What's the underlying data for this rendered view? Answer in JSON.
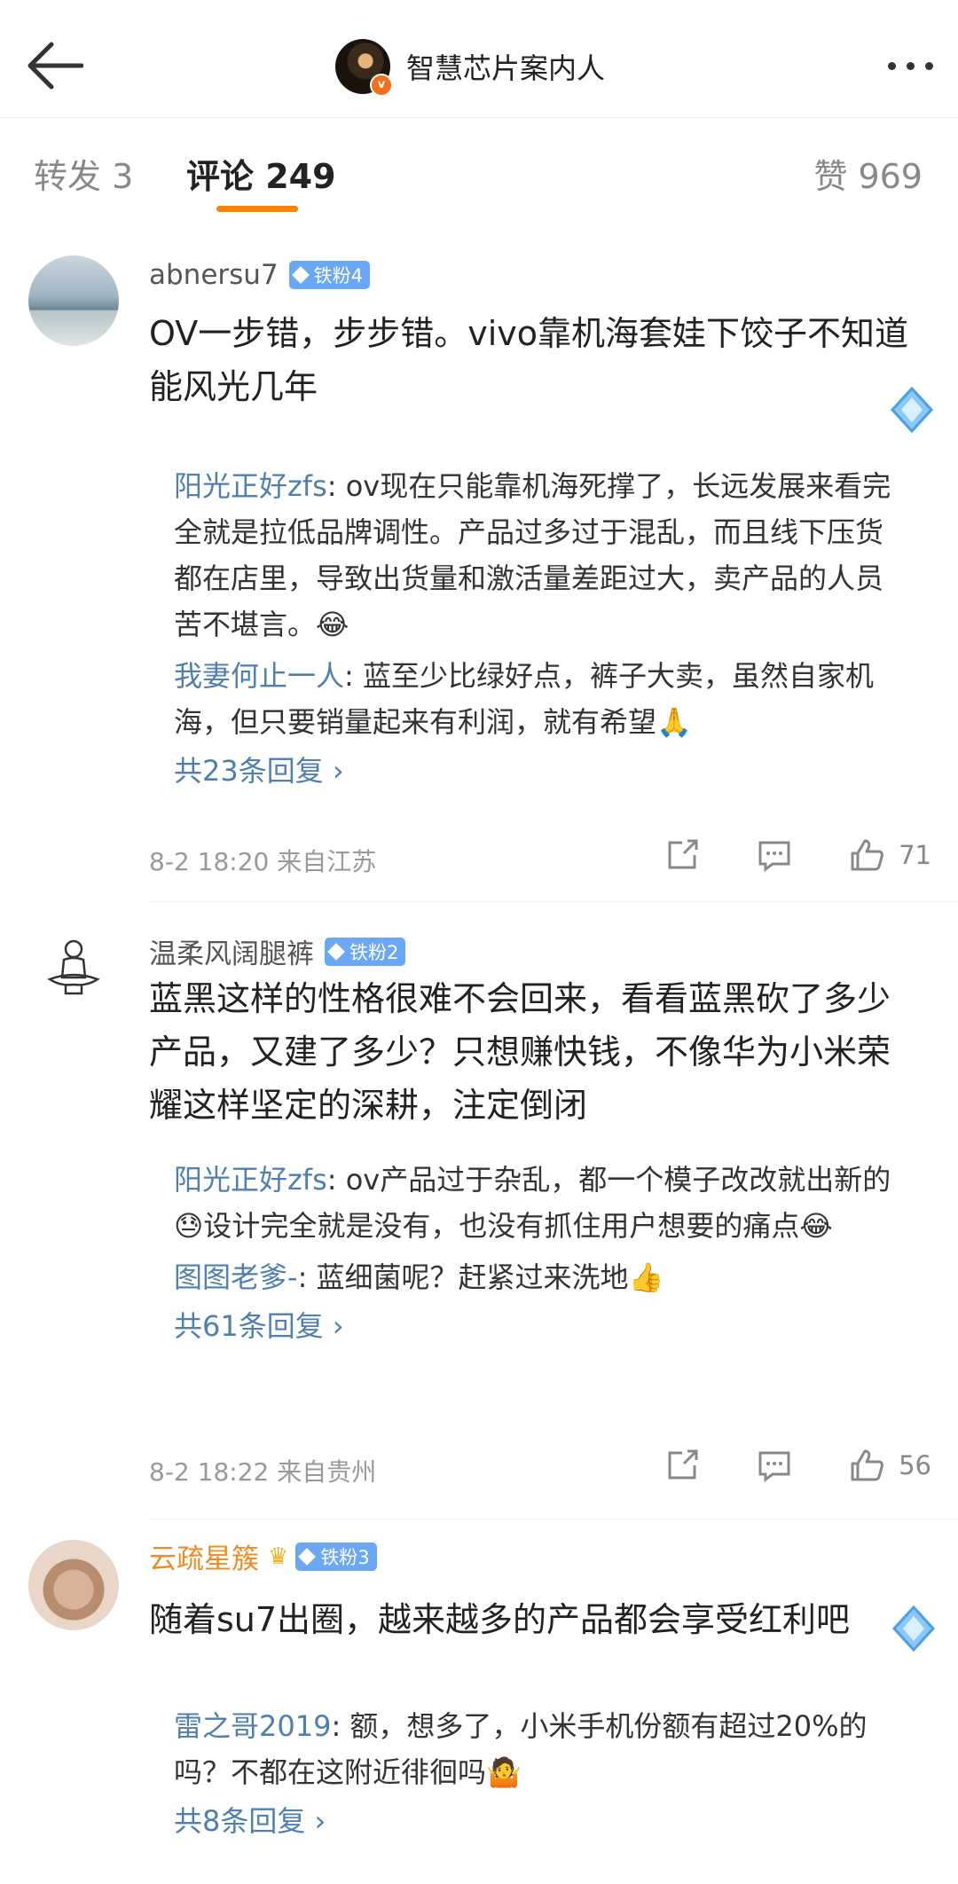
{
  "header": {
    "title": "智慧芯片案内人",
    "back_icon": "back-arrow-icon",
    "more_icon": "more-dots-icon"
  },
  "tabs": {
    "repost": "转发 3",
    "comment": "评论 249",
    "like": "赞 969"
  },
  "colors": {
    "accent": "#ff8200",
    "link": "#4e7fb0",
    "fan_badge": "#6aa7f5"
  },
  "comments": [
    {
      "user": "abnersu7",
      "badge": "铁粉4",
      "text": "OV一步错，步步错。vivo靠机海套娃下饺子不知道能风光几年",
      "replies": [
        {
          "name": "阳光正好zfs",
          "text": ": ov现在只能靠机海死撑了，长远发展来看完全就是拉低品牌调性。产品过多过于混乱，而且线下压货都在店里，导致出货量和激活量差距过大，卖产品的人员苦不堪言。😂"
        },
        {
          "name": "我妻何止一人",
          "text": ": 蓝至少比绿好点，裤子大卖，虽然自家机海，但只要销量起来有利润，就有希望🙏"
        }
      ],
      "more_replies": "共23条回复 ›",
      "meta": "8-2 18:20  来自江苏",
      "likes": "71"
    },
    {
      "user": "温柔风阔腿裤",
      "badge": "铁粉2",
      "text": "蓝黑这样的性格很难不会回来，看看蓝黑砍了多少产品，又建了多少？只想赚快钱，不像华为小米荣耀这样坚定的深耕，注定倒闭",
      "replies": [
        {
          "name": "阳光正好zfs",
          "text": ": ov产品过于杂乱，都一个模子改改就出新的😓设计完全就是没有，也没有抓住用户想要的痛点😂"
        },
        {
          "name": "图图老爹-",
          "text": ": 蓝细菌呢？赶紧过来洗地👍"
        }
      ],
      "more_replies": "共61条回复 ›",
      "meta": "8-2 18:22  来自贵州",
      "likes": "56"
    },
    {
      "user": "云疏星簇",
      "badge": "铁粉3",
      "text": "随着su7出圈，越来越多的产品都会享受红利吧",
      "replies": [
        {
          "name": "雷之哥2019",
          "text": ": 额，想多了，小米手机份额有超过20%的吗？不都在这附近徘徊吗🤷"
        }
      ],
      "more_replies": "共8条回复 ›"
    }
  ]
}
